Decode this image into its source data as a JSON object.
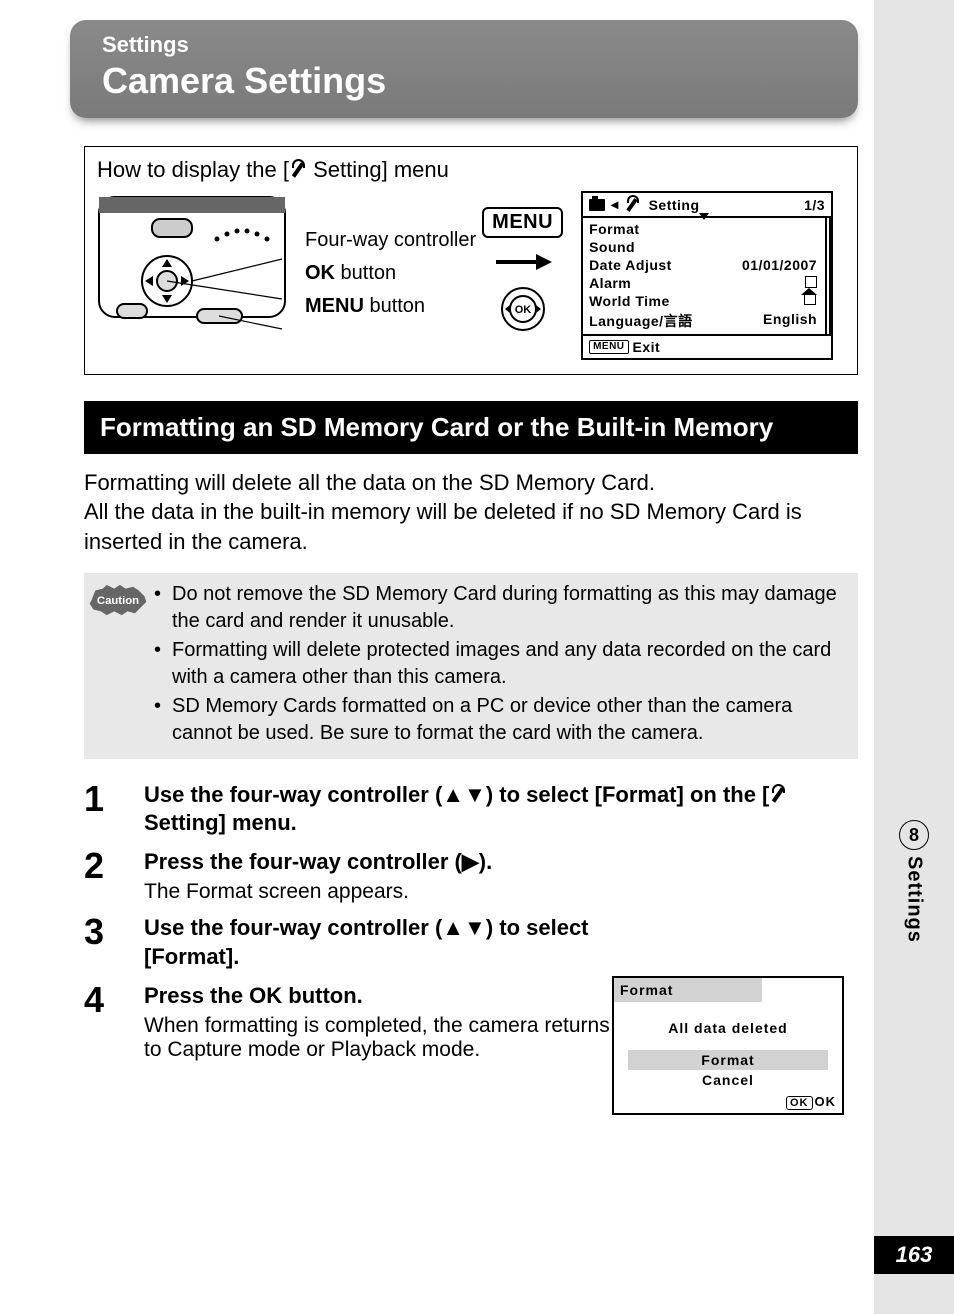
{
  "header": {
    "small": "Settings",
    "big": "Camera Settings"
  },
  "howto": {
    "title_pre": "How to display the [",
    "title_post": " Setting] menu",
    "labels": {
      "fourway": "Four-way controller",
      "ok_b": "OK",
      "ok_rest": " button",
      "menu_b": "MENU",
      "menu_rest": " button"
    },
    "menu_btn": "MENU",
    "ok_btn": "OK"
  },
  "lcd": {
    "title": "Setting",
    "page": "1/3",
    "rows": [
      {
        "label": "Format",
        "value": ""
      },
      {
        "label": "Sound",
        "value": ""
      },
      {
        "label": "Date Adjust",
        "value": "01/01/2007"
      },
      {
        "label": "Alarm",
        "value": "□"
      },
      {
        "label": "World Time",
        "value": "⌂"
      },
      {
        "label": "Language/言語",
        "value": "English"
      }
    ],
    "exit_label": "Exit",
    "menu_mini": "MENU"
  },
  "section_bar": "Formatting an SD Memory Card or the Built-in Memory",
  "intro": "Formatting will delete all the data on the SD Memory Card.\nAll the data in the built-in memory will be deleted if no SD Memory Card is inserted in the camera.",
  "caution_label": "Caution",
  "caution": [
    "Do not remove the SD Memory Card during formatting as this may damage the card and render it unusable.",
    "Formatting will delete protected images and any data recorded on the card with a camera other than this camera.",
    "SD Memory Cards formatted on a PC or device other than the camera cannot be used. Be sure to format the card with the camera."
  ],
  "steps": [
    {
      "n": "1",
      "hd_pre": "Use the four-way controller (▲▼) to select [Format] on the [",
      "hd_post": "Setting] menu.",
      "sub": ""
    },
    {
      "n": "2",
      "hd": "Press the four-way controller (▶).",
      "sub": "The Format screen appears."
    },
    {
      "n": "3",
      "hd": "Use the four-way controller (▲▼) to select [Format].",
      "sub": ""
    },
    {
      "n": "4",
      "hd": "Press the OK button.",
      "sub": "When formatting is completed, the camera returns to Capture mode or Playback mode."
    }
  ],
  "fmt_dialog": {
    "title": "Format",
    "msg": "All data deleted",
    "opt_sel": "Format",
    "opt": "Cancel",
    "foot_box": "OK",
    "foot": "OK"
  },
  "side": {
    "chapter": "8",
    "label": "Settings"
  },
  "page_number": "163"
}
